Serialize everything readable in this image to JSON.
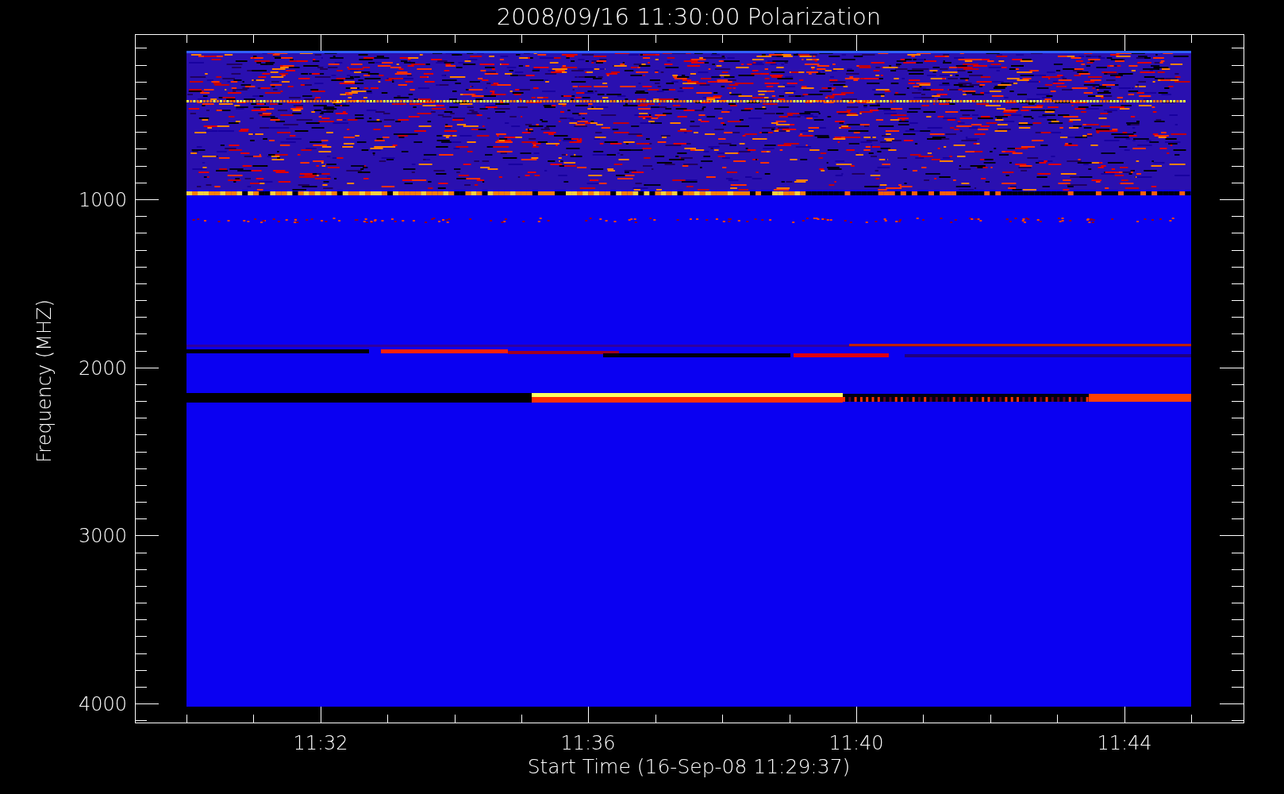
{
  "title": "2008/09/16 11:30:00 Polarization",
  "y_axis": {
    "label": "Frequency (MHZ)",
    "ticks": [
      "1000",
      "2000",
      "3000",
      "4000"
    ]
  },
  "x_axis": {
    "label": "Start Time (16-Sep-08 11:29:37)",
    "ticks": [
      "11:32",
      "11:36",
      "11:40",
      "11:44"
    ]
  }
}
